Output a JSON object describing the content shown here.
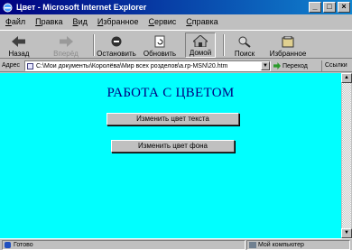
{
  "window": {
    "title": "Цвет - Microsoft Internet Explorer",
    "controls": [
      "_",
      "□",
      "×"
    ]
  },
  "menu": [
    "Файл",
    "Правка",
    "Вид",
    "Избранное",
    "Сервис",
    "Справка"
  ],
  "toolbar": {
    "back": "Назад",
    "forward": "Вперёд",
    "stop": "Остановить",
    "refresh": "Обновить",
    "home": "Домой",
    "search": "Поиск",
    "favorites": "Избранное"
  },
  "address": {
    "label": "Адрес",
    "url": "C:\\Мои документы\\Королёва\\Мир всех розделов\\а.rp-MSN\\20.htm",
    "go": "Переход",
    "links": "Ссылки"
  },
  "page": {
    "heading": "РАБОТА С ЦВЕТОМ",
    "btn_text_color": "Изменить цвет текста",
    "btn_bg_color": "Изменить цвет фона",
    "background": "#00ffff"
  },
  "status": {
    "text": "Готово",
    "zone": "Мой компьютер"
  }
}
